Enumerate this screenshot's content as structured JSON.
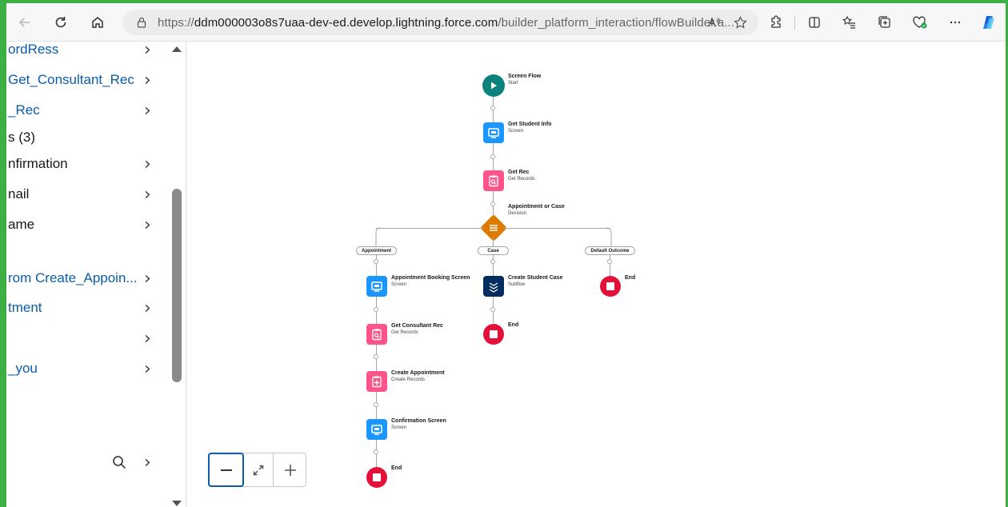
{
  "browser": {
    "url_prefix": "https://",
    "url_host": "ddm000003o8s7uaa-dev-ed.develop.lightning.force.com",
    "url_path": "/builder_platform_interaction/flowBuilder.a...",
    "icons": [
      "back-icon",
      "refresh-icon",
      "home-icon",
      "site-info-icon",
      "read-aloud-icon",
      "favorite-icon",
      "extensions-icon",
      "split-screen-icon",
      "favorites-icon",
      "collections-icon",
      "browser-essentials-icon",
      "more-icon",
      "copilot-icon"
    ]
  },
  "left_panel": {
    "items": [
      {
        "label": "ordRess",
        "style": "link",
        "chevron": true
      },
      {
        "label": "Get_Consultant_Rec",
        "style": "link",
        "chevron": true
      },
      {
        "label": "_Rec",
        "style": "link",
        "chevron": true
      },
      {
        "label": "s (3)",
        "style": "plain",
        "chevron": false
      },
      {
        "label": "nfirmation",
        "style": "plain",
        "chevron": true
      },
      {
        "label": "nail",
        "style": "plain",
        "chevron": true
      },
      {
        "label": "ame",
        "style": "plain",
        "chevron": true
      },
      {
        "label": "rom Create_Appoin...",
        "style": "link",
        "chevron": true
      },
      {
        "label": "tment",
        "style": "link",
        "chevron": true
      },
      {
        "label": "",
        "style": "plain",
        "chevron": true
      },
      {
        "label": "_you",
        "style": "link",
        "chevron": true
      }
    ],
    "chevron_glyph": "›"
  },
  "flow": {
    "start": {
      "title": "Screen Flow",
      "subtitle": "Start"
    },
    "get_student_info": {
      "title": "Get Student Info",
      "subtitle": "Screen"
    },
    "get_rec": {
      "title": "Get Rec",
      "subtitle": "Get Records"
    },
    "decision": {
      "title": "Appointment or Case",
      "subtitle": "Decision"
    },
    "outcomes": {
      "appointment": "Appointment",
      "case": "Case",
      "default": "Default Outcome"
    },
    "appointment_booking": {
      "title": "Appointment Booking Screen",
      "subtitle": "Screen"
    },
    "get_consultant_rec": {
      "title": "Get Consultant Rec",
      "subtitle": "Get Records"
    },
    "create_appointment": {
      "title": "Create Appointment",
      "subtitle": "Create Records"
    },
    "confirmation_screen": {
      "title": "Confirmation Screen",
      "subtitle": "Screen"
    },
    "create_student_case": {
      "title": "Create Student Case",
      "subtitle": "Subflow"
    },
    "end_label": "End"
  },
  "zoom_controls": {
    "zoom_out": "−",
    "fit": "⤢",
    "zoom_in": "+"
  },
  "colors": {
    "frame_green": "#3cb043",
    "screen_blue": "#1b96ff",
    "get_records_pink": "#ff538a",
    "start_teal": "#0b827c",
    "decision_orange": "#dd7a01",
    "subflow_navy": "#032d60",
    "end_red": "#e3103a",
    "link_blue": "#0b5cab"
  }
}
